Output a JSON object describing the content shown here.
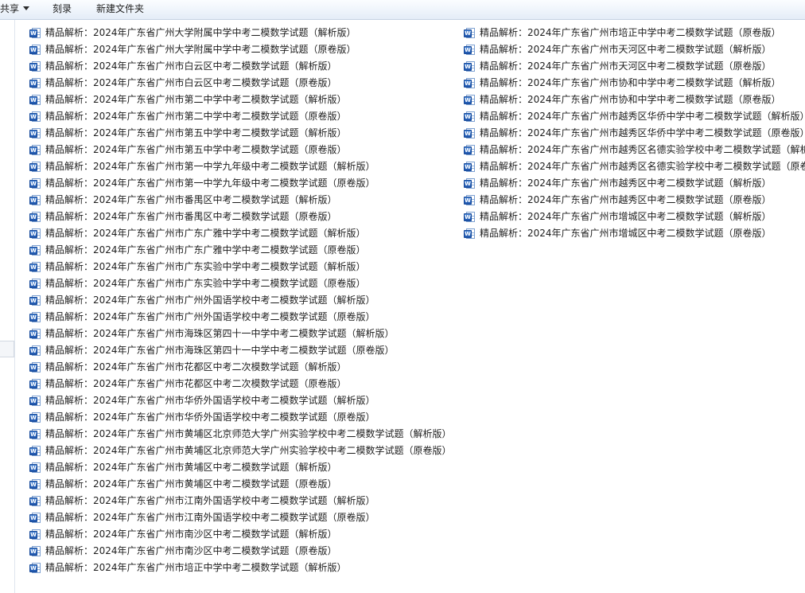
{
  "toolbar": {
    "share_label": "共享",
    "burn_label": "刻录",
    "new_folder_label": "新建文件夹"
  },
  "icon": {
    "name": "word-document-icon",
    "badge_letter": "W",
    "badge_color": "#2a64bd"
  },
  "files": {
    "left": [
      "精品解析：2024年广东省广州大学附属中学中考二模数学试题（解析版）",
      "精品解析：2024年广东省广州大学附属中学中考二模数学试题（原卷版）",
      "精品解析：2024年广东省广州市白云区中考二模数学试题（解析版）",
      "精品解析：2024年广东省广州市白云区中考二模数学试题（原卷版）",
      "精品解析：2024年广东省广州市第二中学中考二模数学试题（解析版）",
      "精品解析：2024年广东省广州市第二中学中考二模数学试题（原卷版）",
      "精品解析：2024年广东省广州市第五中学中考二模数学试题（解析版）",
      "精品解析：2024年广东省广州市第五中学中考二模数学试题（原卷版）",
      "精品解析：2024年广东省广州市第一中学九年级中考二模数学试题（解析版）",
      "精品解析：2024年广东省广州市第一中学九年级中考二模数学试题（原卷版）",
      "精品解析：2024年广东省广州市番禺区中考二模数学试题（解析版）",
      "精品解析：2024年广东省广州市番禺区中考二模数学试题（原卷版）",
      "精品解析：2024年广东省广州市广东广雅中学中考二模数学试题（解析版）",
      "精品解析：2024年广东省广州市广东广雅中学中考二模数学试题（原卷版）",
      "精品解析：2024年广东省广州市广东实验中学中考二模数学试题（解析版）",
      "精品解析：2024年广东省广州市广东实验中学中考二模数学试题（原卷版）",
      "精品解析：2024年广东省广州市广州外国语学校中考二模数学试题（解析版）",
      "精品解析：2024年广东省广州市广州外国语学校中考二模数学试题（原卷版）",
      "精品解析：2024年广东省广州市海珠区第四十一中学中考二模数学试题（解析版）",
      "精品解析：2024年广东省广州市海珠区第四十一中学中考二模数学试题（原卷版）",
      "精品解析：2024年广东省广州市花都区中考二次模数学试题（解析版）",
      "精品解析：2024年广东省广州市花都区中考二次模数学试题（原卷版）",
      "精品解析：2024年广东省广州市华侨外国语学校中考二模数学试题（解析版）",
      "精品解析：2024年广东省广州市华侨外国语学校中考二模数学试题（原卷版）",
      "精品解析：2024年广东省广州市黄埔区北京师范大学广州实验学校中考二模数学试题（解析版）",
      "精品解析：2024年广东省广州市黄埔区北京师范大学广州实验学校中考二模数学试题（原卷版）",
      "精品解析：2024年广东省广州市黄埔区中考二模数学试题（解析版）",
      "精品解析：2024年广东省广州市黄埔区中考二模数学试题（原卷版）",
      "精品解析：2024年广东省广州市江南外国语学校中考二模数学试题（解析版）",
      "精品解析：2024年广东省广州市江南外国语学校中考二模数学试题（原卷版）",
      "精品解析：2024年广东省广州市南沙区中考二模数学试题（解析版）",
      "精品解析：2024年广东省广州市南沙区中考二模数学试题（原卷版）",
      "精品解析：2024年广东省广州市培正中学中考二模数学试题（解析版）"
    ],
    "right": [
      "精品解析：2024年广东省广州市培正中学中考二模数学试题（原卷版）",
      "精品解析：2024年广东省广州市天河区中考二模数学试题（解析版）",
      "精品解析：2024年广东省广州市天河区中考二模数学试题（原卷版）",
      "精品解析：2024年广东省广州市协和中学中考二模数学试题（解析版）",
      "精品解析：2024年广东省广州市协和中学中考二模数学试题（原卷版）",
      "精品解析：2024年广东省广州市越秀区华侨中学中考二模数学试题（解析版）",
      "精品解析：2024年广东省广州市越秀区华侨中学中考二模数学试题（原卷版）",
      "精品解析：2024年广东省广州市越秀区名德实验学校中考二模数学试题（解析",
      "精品解析：2024年广东省广州市越秀区名德实验学校中考二模数学试题（原卷",
      "精品解析：2024年广东省广州市越秀区中考二模数学试题（解析版）",
      "精品解析：2024年广东省广州市越秀区中考二模数学试题（原卷版）",
      "精品解析：2024年广东省广州市增城区中考二模数学试题（解析版）",
      "精品解析：2024年广东省广州市增城区中考二模数学试题（原卷版）"
    ]
  }
}
